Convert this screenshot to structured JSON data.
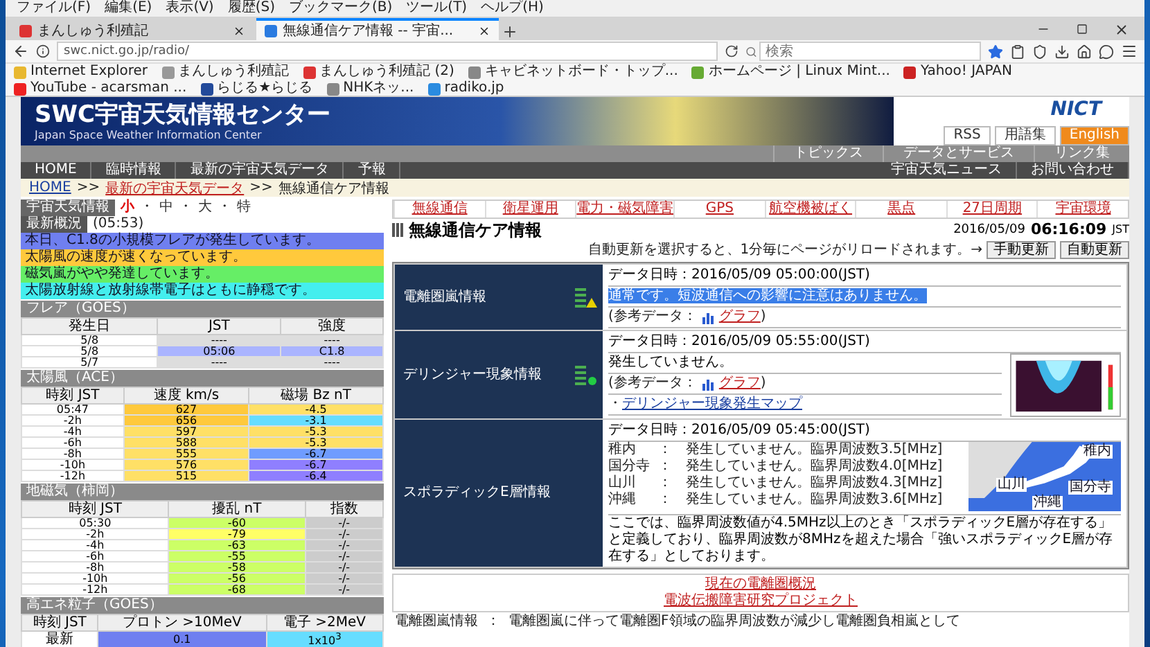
{
  "menu": [
    "ファイル(F)",
    "編集(E)",
    "表示(V)",
    "履歴(S)",
    "ブックマーク(B)",
    "ツール(T)",
    "ヘルプ(H)"
  ],
  "tabs": [
    {
      "title": "まんしゅう利殖記",
      "selected": false
    },
    {
      "title": "無線通信ケア情報 -- 宇宙...",
      "selected": true
    }
  ],
  "address": "swc.nict.go.jp/radio/",
  "search": {
    "placeholder": "検索"
  },
  "bookmarks": [
    "Internet Explorer",
    "まんしゅう利殖記",
    "まんしゅう利殖記 (2)",
    "キャビネットボード・トップ...",
    "ホームページ | Linux Mint...",
    "Yahoo! JAPAN",
    "YouTube - acarsman ...",
    "らじる★らじる",
    "NHKネッ...",
    "radiko.jp"
  ],
  "site": {
    "title": "SWC宇宙天気情報センター",
    "subtitle": "Japan Space Weather Information Center",
    "logo": "NICT",
    "utility_links": [
      {
        "label": "RSS",
        "highlight": false
      },
      {
        "label": "用語集",
        "highlight": false
      },
      {
        "label": "English",
        "highlight": true
      }
    ],
    "upper_nav": [
      "トピックス",
      "データとサービス",
      "リンク集"
    ],
    "nav_left": [
      "HOME",
      "臨時情報",
      "最新の宇宙天気データ",
      "予報"
    ],
    "nav_right": [
      "宇宙天気ニュース",
      "お問い合わせ"
    ],
    "breadcrumb": {
      "home": "HOME",
      "separator": ">>",
      "parent": "最新の宇宙天気データ",
      "current": "無線通信ケア情報"
    }
  },
  "sidebar": {
    "header": "宇宙天気情報",
    "size_separator": "・",
    "font_sizes": [
      {
        "label": "小",
        "selected": true
      },
      {
        "label": "中",
        "selected": false
      },
      {
        "label": "大",
        "selected": false
      },
      {
        "label": "特",
        "selected": false
      }
    ],
    "summary_title": "最新概況",
    "summary_time": "(05:53)",
    "alerts": [
      {
        "text": "本日、C1.8の小規模フレアが発生しています。",
        "color": "#6f7ff0"
      },
      {
        "text": "太陽風の速度が速くなっています。",
        "color": "#ffc93c"
      },
      {
        "text": "磁気嵐がやや発達しています。",
        "color": "#66ee66"
      },
      {
        "text": "太陽放射線と放射線帯電子はともに静穏です。",
        "color": "#44eeee"
      }
    ],
    "tables": [
      {
        "title": "フレア（GOES）",
        "columns": [
          "発生日",
          "JST",
          "強度"
        ],
        "rows": [
          [
            {
              "text": "5/8",
              "color": "#ffffff"
            },
            {
              "text": "----",
              "color": "#dddddd"
            },
            {
              "text": "----",
              "color": "#dddddd"
            }
          ],
          [
            {
              "text": "5/8",
              "color": "#ffffff"
            },
            {
              "text": "05:06",
              "color": "#aab4ff"
            },
            {
              "text": "C1.8",
              "color": "#aab4ff"
            }
          ],
          [
            {
              "text": "5/7",
              "color": "#ffffff"
            },
            {
              "text": "----",
              "color": "#dddddd"
            },
            {
              "text": "----",
              "color": "#dddddd"
            }
          ]
        ]
      },
      {
        "title": "太陽風（ACE）",
        "columns": [
          "時刻 JST",
          "速度 km/s",
          "磁場 Bz nT"
        ],
        "rows": [
          [
            {
              "text": "05:47",
              "color": "#ffffff"
            },
            {
              "text": "627",
              "color": "#ffc93c"
            },
            {
              "text": "-4.5",
              "color": "#ffe066"
            }
          ],
          [
            {
              "text": "-2h",
              "color": "#ffffff"
            },
            {
              "text": "656",
              "color": "#ffc93c"
            },
            {
              "text": "-3.1",
              "color": "#66ddff"
            }
          ],
          [
            {
              "text": "-4h",
              "color": "#ffffff"
            },
            {
              "text": "597",
              "color": "#ffe066"
            },
            {
              "text": "-5.3",
              "color": "#ffe066"
            }
          ],
          [
            {
              "text": "-6h",
              "color": "#ffffff"
            },
            {
              "text": "588",
              "color": "#ffe066"
            },
            {
              "text": "-5.3",
              "color": "#ffe066"
            }
          ],
          [
            {
              "text": "-8h",
              "color": "#ffffff"
            },
            {
              "text": "555",
              "color": "#ffe066"
            },
            {
              "text": "-6.7",
              "color": "#6f9cff"
            }
          ],
          [
            {
              "text": "-10h",
              "color": "#ffffff"
            },
            {
              "text": "576",
              "color": "#ffe066"
            },
            {
              "text": "-6.7",
              "color": "#8f7fff"
            }
          ],
          [
            {
              "text": "-12h",
              "color": "#ffffff"
            },
            {
              "text": "515",
              "color": "#ffe066"
            },
            {
              "text": "-6.4",
              "color": "#8f7fff"
            }
          ]
        ]
      },
      {
        "title": "地磁気（柿岡）",
        "columns": [
          "時刻 JST",
          "擾乱 nT",
          "指数"
        ],
        "rows": [
          [
            {
              "text": "05:30",
              "color": "#ffffff"
            },
            {
              "text": "-60",
              "color": "#ccff66"
            },
            {
              "text": "-/-",
              "color": "#cccccc"
            }
          ],
          [
            {
              "text": "-2h",
              "color": "#ffffff"
            },
            {
              "text": "-79",
              "color": "#ffff66"
            },
            {
              "text": "-/-",
              "color": "#cccccc"
            }
          ],
          [
            {
              "text": "-4h",
              "color": "#ffffff"
            },
            {
              "text": "-63",
              "color": "#ccff66"
            },
            {
              "text": "-/-",
              "color": "#cccccc"
            }
          ],
          [
            {
              "text": "-6h",
              "color": "#ffffff"
            },
            {
              "text": "-55",
              "color": "#ccff66"
            },
            {
              "text": "-/-",
              "color": "#cccccc"
            }
          ],
          [
            {
              "text": "-8h",
              "color": "#ffffff"
            },
            {
              "text": "-58",
              "color": "#ccff66"
            },
            {
              "text": "-/-",
              "color": "#cccccc"
            }
          ],
          [
            {
              "text": "-10h",
              "color": "#ffffff"
            },
            {
              "text": "-56",
              "color": "#ccff66"
            },
            {
              "text": "-/-",
              "color": "#cccccc"
            }
          ],
          [
            {
              "text": "-12h",
              "color": "#ffffff"
            },
            {
              "text": "-68",
              "color": "#ccff66"
            },
            {
              "text": "-/-",
              "color": "#cccccc"
            }
          ]
        ]
      },
      {
        "title": "高エネ粒子（GOES）",
        "columns": [
          "時刻 JST",
          "プロトン >10MeV",
          "電子 >2MeV"
        ],
        "rows": [
          [
            {
              "text": "最新",
              "color": "#ffffff"
            },
            {
              "text": "0.1",
              "color": "#6f7ff0"
            },
            {
              "text": "1x10$^{3}$",
              "color": "#66ddff"
            }
          ]
        ]
      }
    ]
  },
  "categories": [
    "無線通信",
    "衛星運用",
    "電力・磁気障害",
    "GPS",
    "航空機被ばく",
    "黒点",
    "27日周期",
    "宇宙環境"
  ],
  "page": {
    "title": "無線通信ケア情報",
    "date": "2016/05/09",
    "time": "06:16:09",
    "tz": "JST"
  },
  "auto_update": {
    "note": "自動更新を選択すると、1分毎にページがリロードされます。→",
    "buttons": [
      "手動更新",
      "自動更新"
    ]
  },
  "panels": [
    {
      "name": "電離圏嵐情報",
      "warning": true,
      "date": "データ日時：2016/05/09 05:00:00(JST)",
      "blocks": [
        {
          "kind": "highlight",
          "text": "通常です。短波通信への影響に注意はありません。"
        },
        {
          "kind": "reference",
          "prefix": "(参考データ：",
          "link": "グラフ",
          "suffix": ")"
        }
      ]
    },
    {
      "name": "デリンジャー現象情報",
      "warning": false,
      "date": "データ日時：2016/05/09 05:55:00(JST)",
      "blocks": [
        {
          "kind": "text",
          "text": "発生していません。"
        },
        {
          "kind": "reference",
          "prefix": "(参考データ：",
          "link": "グラフ",
          "suffix": ")"
        },
        {
          "kind": "link",
          "bullet": "・",
          "text": "デリンジャー現象発生マップ"
        }
      ],
      "figure": {
        "kind": "plot"
      }
    },
    {
      "name": "スポラディックE層情報",
      "date": "データ日時：2016/05/09 05:45:00(JST)",
      "blocks": [
        {
          "kind": "station",
          "station": "稚内",
          "text": "：　発生していません。臨界周波数3.5[MHz]"
        },
        {
          "kind": "station",
          "station": "国分寺",
          "text": "：　発生していません。臨界周波数4.0[MHz]"
        },
        {
          "kind": "station",
          "station": "山川",
          "text": "：　発生していません。臨界周波数4.3[MHz]"
        },
        {
          "kind": "station",
          "station": "沖縄",
          "text": "：　発生していません。臨界周波数3.6[MHz]"
        }
      ],
      "figure": {
        "kind": "map",
        "labels": [
          "稚内",
          "山川",
          "国分寺",
          "沖縄"
        ]
      },
      "note": "ここでは、臨界周波数値が4.5MHz以上のとき「スポラディックE層が存在する」と定義しており、臨界周波数が8MHzを超えた場合「強いスポラディックE層が存在する」としております。"
    }
  ],
  "bottom_links": [
    "現在の電離圏概況",
    "電波伝搬障害研究プロジェクト"
  ],
  "footnote": {
    "term": "電離圏嵐情報",
    "separator": "：",
    "text": "電離圏嵐に伴って電離圏F領域の臨界周波数が減少し電離圏負相嵐として"
  }
}
